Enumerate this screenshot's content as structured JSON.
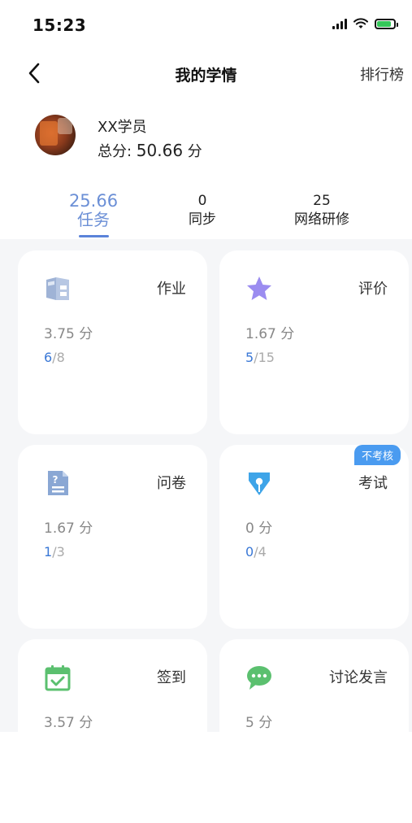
{
  "status": {
    "time": "15:23"
  },
  "nav": {
    "title": "我的学情",
    "rank_label": "排行榜"
  },
  "profile": {
    "name": "XX学员",
    "score_label": "总分: ",
    "score_value": "50.66",
    "score_unit": " 分"
  },
  "tabs": [
    {
      "value": "25.66",
      "label": "任务",
      "active": true
    },
    {
      "value": "0",
      "label": "同步",
      "active": false
    },
    {
      "value": "25",
      "label": "网络研修",
      "active": false
    }
  ],
  "cards": [
    {
      "title": "作业",
      "icon": "homework-icon",
      "score": "3.75 分",
      "done": "6",
      "sep": "/",
      "total": "8"
    },
    {
      "title": "评价",
      "icon": "star-icon",
      "score": "1.67 分",
      "done": "5",
      "sep": "/",
      "total": "15"
    },
    {
      "title": "问卷",
      "icon": "questionnaire-icon",
      "score": "1.67 分",
      "done": "1",
      "sep": "/",
      "total": "3"
    },
    {
      "title": "考试",
      "icon": "exam-pen-icon",
      "score": "0 分",
      "done": "0",
      "sep": "/",
      "total": "4",
      "badge": "不考核"
    },
    {
      "title": "签到",
      "icon": "calendar-check-icon",
      "score": "3.57 分"
    },
    {
      "title": "讨论发言",
      "icon": "chat-bubble-icon",
      "score": "5 分"
    }
  ],
  "colors": {
    "accent": "#5b83d9",
    "done_count": "#3a78d6",
    "badge": "#4a9bf0",
    "homework_icon": "#9fb3d6",
    "star_icon": "#9b8cf0",
    "questionnaire_icon": "#8aa7d4",
    "exam_icon": "#3ea4e8",
    "checkin_icon": "#5bc06f",
    "chat_icon": "#5bc06f"
  }
}
